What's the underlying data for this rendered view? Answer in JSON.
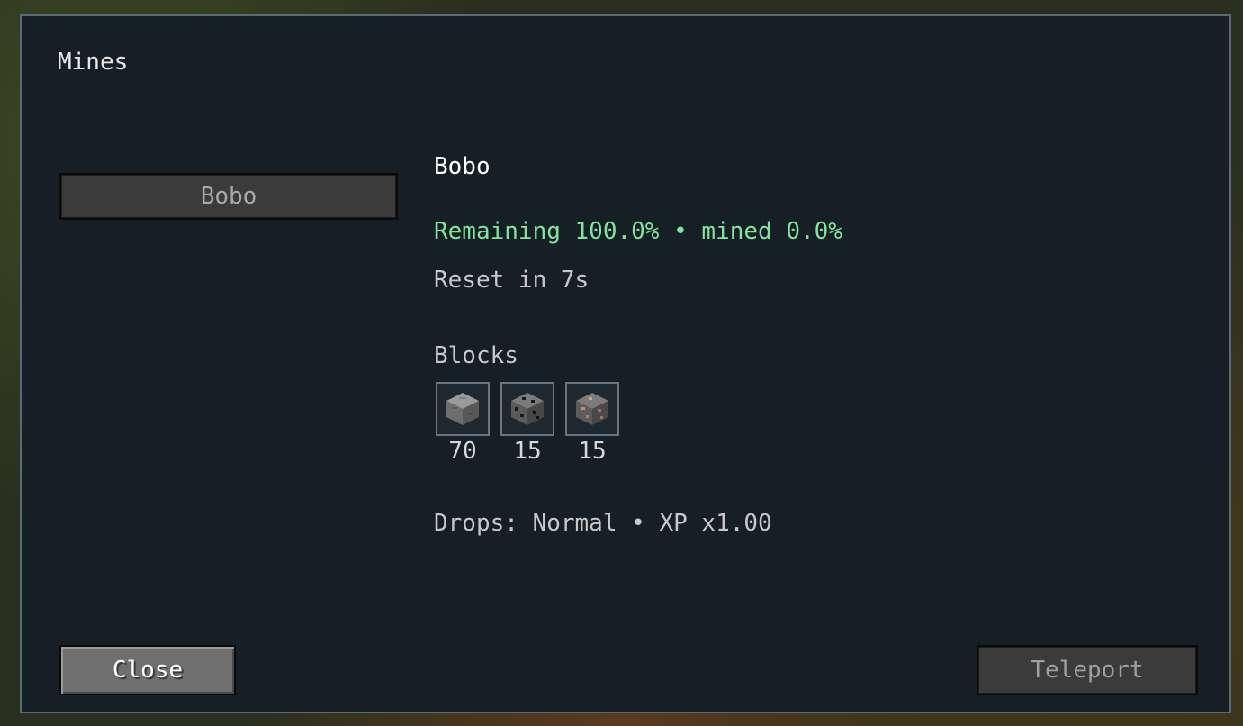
{
  "screen": {
    "title": "Mines"
  },
  "mine_list": {
    "items": [
      {
        "label": "Bobo"
      }
    ]
  },
  "detail": {
    "name": "Bobo",
    "remaining_text": "Remaining 100.0% • mined 0.0%",
    "reset_text": "Reset in 7s",
    "blocks_label": "Blocks",
    "blocks": [
      {
        "icon": "stone-block-icon",
        "count": "70"
      },
      {
        "icon": "coal-ore-icon",
        "count": "15"
      },
      {
        "icon": "iron-ore-icon",
        "count": "15"
      }
    ],
    "drops_text": "Drops: Normal • XP x1.00"
  },
  "buttons": {
    "close_label": "Close",
    "teleport_label": "Teleport"
  },
  "colors": {
    "panel_bg": "#161e26",
    "panel_border": "#5a6b78",
    "status_green": "#7ee59a"
  }
}
